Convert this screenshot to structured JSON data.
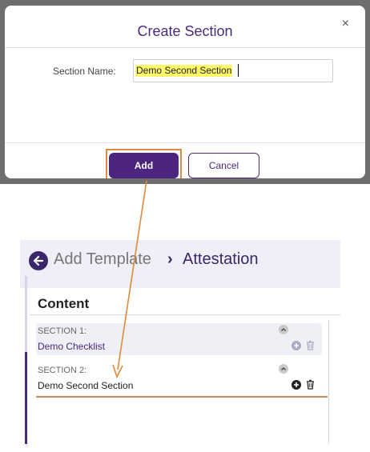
{
  "modal": {
    "title": "Create Section",
    "close_glyph": "×",
    "field_label": "Section Name:",
    "field_value": "Demo Second Section",
    "add_label": "Add",
    "cancel_label": "Cancel"
  },
  "page": {
    "breadcrumb": {
      "root": "Add Template",
      "separator": "›",
      "current": "Attestation"
    },
    "content_title": "Content",
    "sections": [
      {
        "label": "SECTION 1:",
        "name": "Demo Checklist"
      },
      {
        "label": "SECTION 2:",
        "name": "Demo Second Section"
      }
    ]
  },
  "colors": {
    "accent": "#4b2580",
    "highlight": "#e08a3b",
    "input_highlight": "#fff86a"
  },
  "icons": [
    "close-icon",
    "back-arrow-icon",
    "chevron-up-icon",
    "plus-icon",
    "trash-icon"
  ]
}
